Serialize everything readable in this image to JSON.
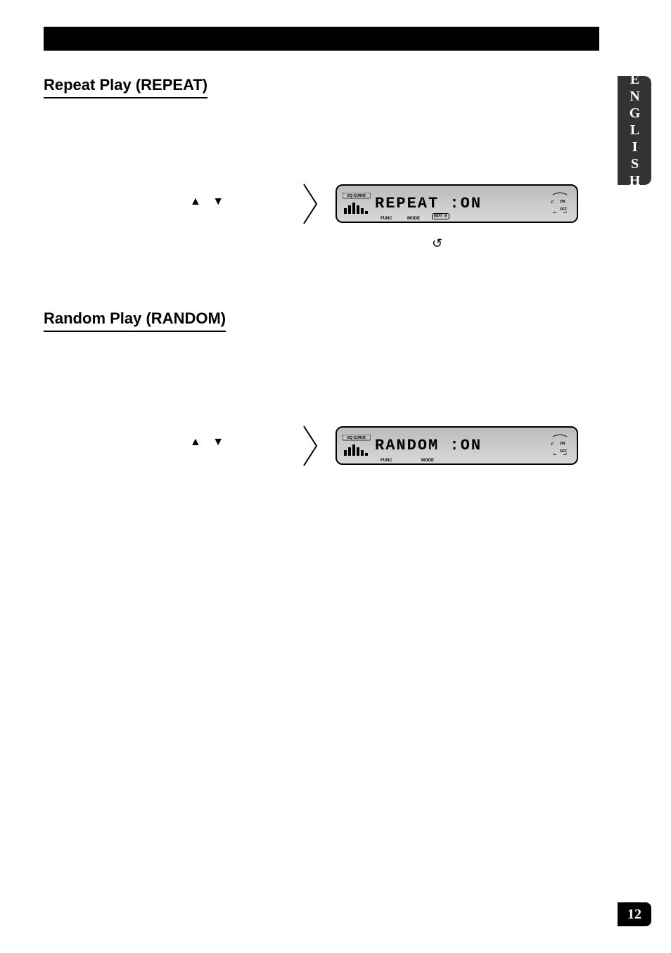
{
  "sideTab": "ENGLISH",
  "pageNumber": "12",
  "sections": [
    {
      "heading": "Repeat Play (REPEAT)",
      "arrowGlyphs": "▲ ▼",
      "displayText": "REPEAT :ON",
      "hasRptCallout": true
    },
    {
      "heading": "Random Play (RANDOM)",
      "arrowGlyphs": "▲ ▼",
      "displayText": "RANDOM :ON",
      "hasRptCallout": false
    }
  ],
  "lcdLabels": {
    "eqCurve": "EQ CURVE",
    "func": "FUNC",
    "mode": "MODE",
    "rpt": "RPT",
    "on": "ON",
    "off": "OFF",
    "f": "F"
  },
  "subIndicatorGlyph": "↺"
}
